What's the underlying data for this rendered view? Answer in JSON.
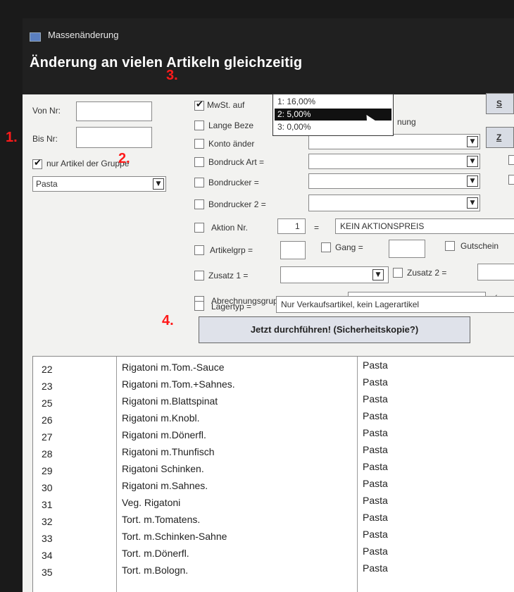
{
  "window": {
    "title": "Massenänderung",
    "heading": "Änderung an vielen Artikeln gleichzeitig"
  },
  "annotations": {
    "a1": "1.",
    "a2": "2.",
    "a3": "3.",
    "a4": "4."
  },
  "left": {
    "von_label": "Von Nr:",
    "bis_label": "Bis Nr:",
    "group_checkbox_label": "nur Artikel der Gruppe",
    "group_value": "Pasta"
  },
  "options": {
    "mwst": "MwSt. auf",
    "lange": "Lange Beze",
    "lange_tail": "nung",
    "konto": "Konto änder",
    "bondruck_art": "Bondruck Art =",
    "bondrucker": "Bondrucker =",
    "bondrucker2": "Bondrucker 2 =",
    "aktion": "Aktion Nr.",
    "aktion_nr": "1",
    "aktion_eq": "=",
    "aktion_value": "KEIN AKTIONSPREIS",
    "artikelgrp": "Artikelgrp =",
    "gang": "Gang =",
    "gutschein": "Gutschein",
    "zusatz1": "Zusatz 1 =",
    "zusatz2": "Zusatz 2 =",
    "abrechnung": "Abrechnungsgruppe =",
    "abrechnung_tail": "(ma",
    "lagertyp": "Lagertyp =",
    "lagertyp_value": "Nur Verkaufsartikel, kein Lagerartikel"
  },
  "mwst_dropdown": {
    "options": [
      "1: 16,00%",
      "2: 5,00%",
      "3: 0,00%"
    ],
    "selected_index": 1
  },
  "side_buttons": {
    "b1": "S",
    "b2": "Z"
  },
  "run_button": "Jetzt durchführen! (Sicherheitskopie?)",
  "articles": [
    {
      "nr": "22",
      "name": "Rigatoni m.Tom.-Sauce",
      "group": "Pasta"
    },
    {
      "nr": "23",
      "name": "Rigatoni m.Tom.+Sahnes.",
      "group": "Pasta"
    },
    {
      "nr": "25",
      "name": "Rigatoni m.Blattspinat",
      "group": "Pasta"
    },
    {
      "nr": "26",
      "name": "Rigatoni m.Knobl.",
      "group": "Pasta"
    },
    {
      "nr": "27",
      "name": "Rigatoni m.Dönerfl.",
      "group": "Pasta"
    },
    {
      "nr": "28",
      "name": "Rigatoni m.Thunfisch",
      "group": "Pasta"
    },
    {
      "nr": "29",
      "name": "Rigatoni Schinken.",
      "group": "Pasta"
    },
    {
      "nr": "30",
      "name": "Rigatoni m.Sahnes.",
      "group": "Pasta"
    },
    {
      "nr": "31",
      "name": "Veg. Rigatoni",
      "group": "Pasta"
    },
    {
      "nr": "32",
      "name": "Tort. m.Tomatens.",
      "group": "Pasta"
    },
    {
      "nr": "33",
      "name": "Tort. m.Schinken-Sahne",
      "group": "Pasta"
    },
    {
      "nr": "34",
      "name": "Tort. m.Dönerfl.",
      "group": "Pasta"
    },
    {
      "nr": "35",
      "name": "Tort. m.Bologn.",
      "group": "Pasta"
    }
  ]
}
